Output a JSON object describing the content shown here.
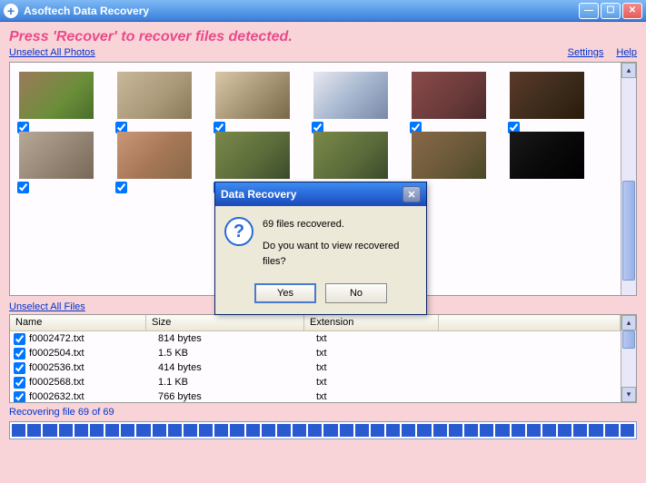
{
  "window": {
    "title": "Asoftech Data Recovery"
  },
  "instruction": "Press 'Recover' to recover files detected.",
  "links": {
    "unselect_photos": "Unselect All Photos",
    "unselect_files": "Unselect All Files",
    "settings": "Settings",
    "help": "Help"
  },
  "file_table": {
    "headers": {
      "name": "Name",
      "size": "Size",
      "ext": "Extension"
    },
    "rows": [
      {
        "name": "f0002472.txt",
        "size": "814 bytes",
        "ext": "txt"
      },
      {
        "name": "f0002504.txt",
        "size": "1.5 KB",
        "ext": "txt"
      },
      {
        "name": "f0002536.txt",
        "size": "414 bytes",
        "ext": "txt"
      },
      {
        "name": "f0002568.txt",
        "size": "1.1 KB",
        "ext": "txt"
      },
      {
        "name": "f0002632.txt",
        "size": "766 bytes",
        "ext": "txt"
      }
    ]
  },
  "status": "Recovering file 69 of 69",
  "dialog": {
    "title": "Data Recovery",
    "line1": "69 files recovered.",
    "line2": "Do you want to view recovered files?",
    "yes": "Yes",
    "no": "No"
  }
}
